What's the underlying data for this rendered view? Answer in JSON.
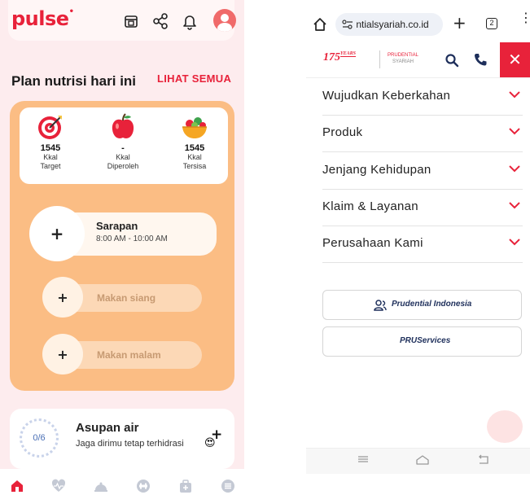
{
  "left_app": {
    "logo": "pulse",
    "plan": {
      "title": "Plan nutrisi hari ini",
      "see_all": "LIHAT SEMUA"
    },
    "kcal": [
      {
        "value": "1545",
        "label1": "Kkal",
        "label2": "Target",
        "icon": "target-icon"
      },
      {
        "value": "-",
        "label1": "Kkal",
        "label2": "Diperoleh",
        "icon": "apple-icon"
      },
      {
        "value": "1545",
        "label1": "Kkal",
        "label2": "Tersisa",
        "icon": "salad-bowl-icon"
      }
    ],
    "meals": {
      "breakfast": {
        "plus": "+",
        "title": "Sarapan",
        "time": "8:00 AM - 10:00 AM"
      },
      "lunch": {
        "plus": "+",
        "title": "Makan siang"
      },
      "dinner": {
        "plus": "+",
        "title": "Makan malam"
      }
    },
    "water": {
      "progress": "0/6",
      "title": "Asupan air",
      "subtitle": "Jaga dirimu tetap terhidrasi",
      "emoji": "😍",
      "plus": "+"
    },
    "colors": {
      "brand": "#e8223a",
      "orange": "#fbbd84",
      "pink_bg": "#fdecee"
    }
  },
  "right_app": {
    "browser": {
      "url": "ntialsyariah.co.id",
      "tab_count": "2",
      "plus": "+",
      "kebab": "⋮"
    },
    "header": {
      "years_num": "175",
      "years_word": "YEARS",
      "logo_line1": "PRUDENTIAL",
      "logo_line2": "SYARIAH",
      "close": "✕"
    },
    "menu": [
      {
        "label": "Wujudkan Keberkahan"
      },
      {
        "label": "Produk"
      },
      {
        "label": "Jenjang Kehidupan"
      },
      {
        "label": "Klaim & Layanan"
      },
      {
        "label": "Perusahaan Kami"
      }
    ],
    "buttons": {
      "prudential_indonesia": "Prudential Indonesia",
      "pruservices": "PRUServices"
    },
    "colors": {
      "brand": "#e8223a",
      "navy": "#1e2f5b"
    }
  }
}
